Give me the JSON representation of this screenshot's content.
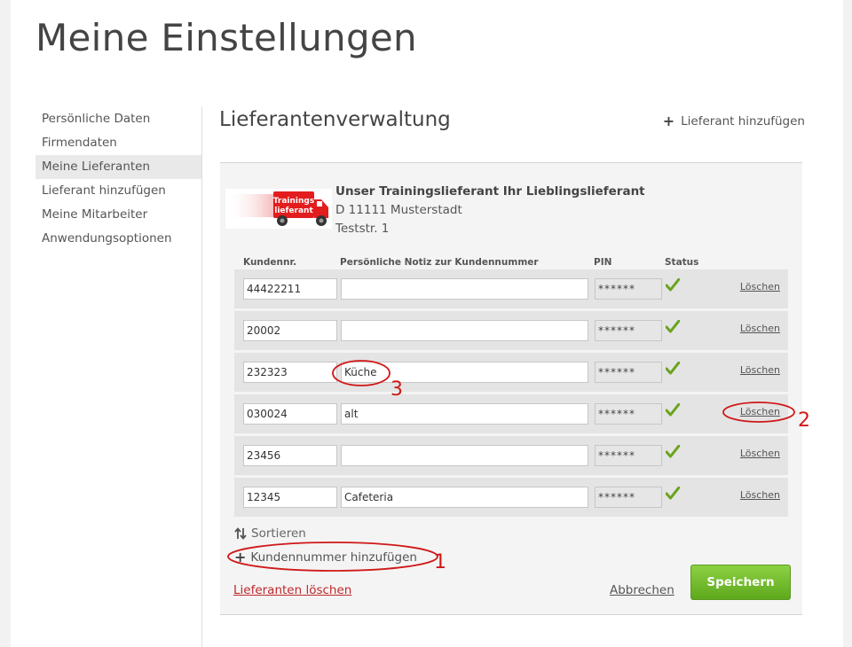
{
  "page_title": "Meine Einstellungen",
  "sidebar": {
    "items": [
      {
        "label": "Persönliche Daten"
      },
      {
        "label": "Firmendaten"
      },
      {
        "label": "Meine Lieferanten",
        "active": true
      },
      {
        "label": "Lieferant hinzufügen"
      },
      {
        "label": "Meine Mitarbeiter"
      },
      {
        "label": "Anwendungsoptionen"
      }
    ]
  },
  "section": {
    "title": "Lieferantenverwaltung",
    "add_supplier_label": "Lieferant hinzufügen"
  },
  "supplier": {
    "logo_text_line1": "Trainings",
    "logo_text_line2": "lieferant",
    "name": "Unser Trainingslieferant Ihr Lieblingslieferant",
    "address_line1": "D 11111 Musterstadt",
    "address_line2": "Teststr. 1"
  },
  "table": {
    "headers": {
      "kundennr": "Kundennr.",
      "note": "Persönliche Notiz zur Kundennummer",
      "pin": "PIN",
      "status": "Status"
    },
    "rows": [
      {
        "kundennr": "44422211",
        "note": "",
        "pin": "******",
        "delete_label": "Löschen"
      },
      {
        "kundennr": "20002",
        "note": "",
        "pin": "******",
        "delete_label": "Löschen"
      },
      {
        "kundennr": "232323",
        "note": "Küche",
        "pin": "******",
        "delete_label": "Löschen"
      },
      {
        "kundennr": "030024",
        "note": "alt",
        "pin": "******",
        "delete_label": "Löschen"
      },
      {
        "kundennr": "23456",
        "note": "",
        "pin": "******",
        "delete_label": "Löschen"
      },
      {
        "kundennr": "12345",
        "note": "Cafeteria",
        "pin": "******",
        "delete_label": "Löschen"
      }
    ]
  },
  "actions": {
    "sort_label": "Sortieren",
    "add_customer_number_label": "Kundennummer hinzufügen",
    "delete_suppliers_label": "Lieferanten löschen",
    "cancel_label": "Abbrechen",
    "save_label": "Speichern"
  },
  "annotations": {
    "callout_1": "1",
    "callout_2": "2",
    "callout_3": "3"
  },
  "colors": {
    "accent_green": "#6ab82a",
    "danger_red": "#c0282c",
    "check_green": "#6aa41c",
    "callout_red": "#d01818",
    "logo_truck_red": "#e31d1d"
  }
}
